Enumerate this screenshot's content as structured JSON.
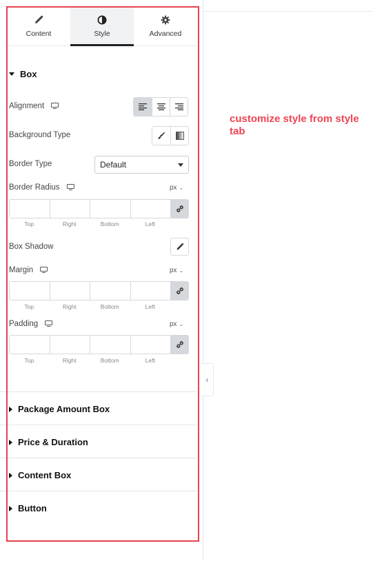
{
  "tabs": [
    {
      "label": "Content",
      "icon": "pencil-icon"
    },
    {
      "label": "Style",
      "icon": "contrast-icon",
      "active": true
    },
    {
      "label": "Advanced",
      "icon": "gear-icon"
    }
  ],
  "box_section": {
    "title": "Box",
    "alignment": {
      "label": "Alignment",
      "options": [
        "align-left-icon",
        "align-center-icon",
        "align-right-icon"
      ],
      "selected": "align-left-icon"
    },
    "background_type": {
      "label": "Background Type",
      "options": [
        "brush-icon",
        "gradient-icon"
      ]
    },
    "border_type": {
      "label": "Border Type",
      "value": "Default"
    },
    "border_radius": {
      "label": "Border Radius",
      "unit": "px",
      "sides": [
        "Top",
        "Right",
        "Bottom",
        "Left"
      ]
    },
    "box_shadow": {
      "label": "Box Shadow"
    },
    "margin": {
      "label": "Margin",
      "unit": "px",
      "sides": [
        "Top",
        "Right",
        "Bottom",
        "Left"
      ]
    },
    "padding": {
      "label": "Padding",
      "unit": "px",
      "sides": [
        "Top",
        "Right",
        "Bottom",
        "Left"
      ]
    }
  },
  "collapsed_sections": [
    {
      "title": "Package Amount Box"
    },
    {
      "title": "Price & Duration"
    },
    {
      "title": "Content Box"
    },
    {
      "title": "Button"
    }
  ],
  "annotation": {
    "text": "customize style from style tab",
    "color": "#ef4452"
  },
  "colors": {
    "highlight": "#e8424d",
    "active_tab": "#1f2124"
  }
}
